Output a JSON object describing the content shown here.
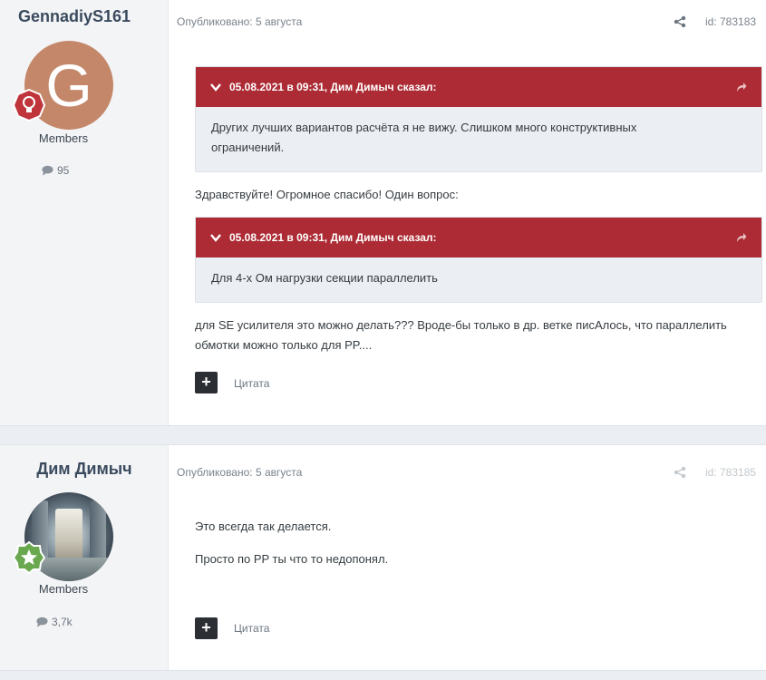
{
  "posts": [
    {
      "author": "GennadiyS161",
      "avatar_letter": "G",
      "avatar_color": "#c4876a",
      "badge_icon": "lightbulb-icon",
      "badge_color": "#c0353b",
      "role": "Members",
      "post_count": "95",
      "published": "Опубликовано: 5 августа",
      "post_id": "id: 783183",
      "quotes": [
        {
          "header": "05.08.2021 в 09:31, Дим Димыч сказал:",
          "body": "Других лучших вариантов расчёта я не вижу.  Слишком много конструктивных ограничений."
        },
        {
          "header": "05.08.2021 в 09:31, Дим Димыч сказал:",
          "body": "Для 4-х Ом нагрузки  секции  параллелить"
        }
      ],
      "text1": "Здравствуйте! Огромное спасибо! Один вопрос:",
      "text2": "для SE усилителя это можно делать??? Вроде-бы только в др. ветке писАлось, что параллелить обмотки можно только для PP....",
      "quote_button": "Цитата"
    },
    {
      "author": "Дим Димыч",
      "badge_icon": "star-icon",
      "badge_color": "#6aa84f",
      "role": "Members",
      "post_count": "3,7k",
      "published": "Опубликовано: 5 августа",
      "post_id": "id: 783185",
      "text1": "Это всегда так делается.",
      "text2": "Просто по PP ты что то недопонял.",
      "quote_button": "Цитата"
    }
  ],
  "colors": {
    "quote_header": "#ac2b34",
    "page_bg": "#ebeef2",
    "author_name": "#3a4a5e"
  }
}
